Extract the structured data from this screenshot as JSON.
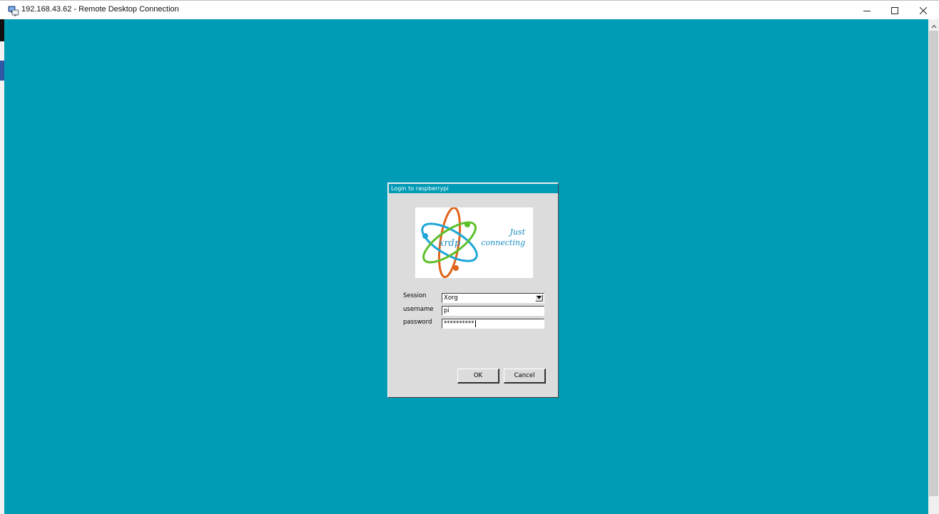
{
  "window": {
    "title": "192.168.43.62 - Remote Desktop Connection",
    "controls": {
      "minimize": "minimize",
      "maximize": "maximize",
      "close": "close"
    }
  },
  "colors": {
    "desktop_background": "#009bb5",
    "dialog_background": "#dcdcdc",
    "dialog_title_background": "#009bb5"
  },
  "dialog": {
    "title": "Login to raspberrypi",
    "logo": {
      "brand": "xrdp",
      "tagline_line1": "Just",
      "tagline_line2": "connecting"
    },
    "fields": {
      "session": {
        "label": "Session",
        "value": "Xorg"
      },
      "username": {
        "label": "username",
        "value": "pi"
      },
      "password": {
        "label": "password",
        "value": "**********"
      }
    },
    "buttons": {
      "ok": "OK",
      "cancel": "Cancel"
    }
  },
  "icons": {
    "app": "remote-desktop-icon",
    "minimize": "minimize-icon",
    "maximize": "maximize-icon",
    "close": "close-icon",
    "scroll_up": "chevron-up-icon",
    "dropdown": "chevron-down-icon"
  }
}
